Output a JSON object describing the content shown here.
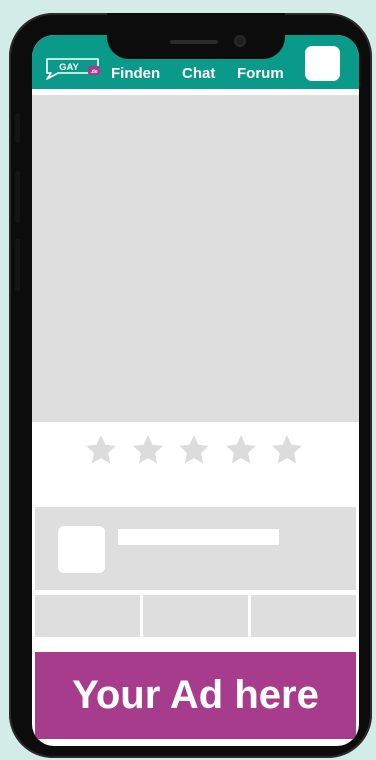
{
  "header": {
    "logo_text": "GAY",
    "logo_badge": ".de",
    "nav": [
      "Finden",
      "Chat",
      "Forum"
    ]
  },
  "rating": {
    "max": 5,
    "value": 0
  },
  "ad": {
    "label": "Your Ad here"
  },
  "colors": {
    "header_bg": "#0a9a8a",
    "placeholder_gray": "#dedede",
    "star_gray": "#dcdcdc",
    "ad_bg": "#a83c8c",
    "logo_badge": "#a83c8c"
  }
}
